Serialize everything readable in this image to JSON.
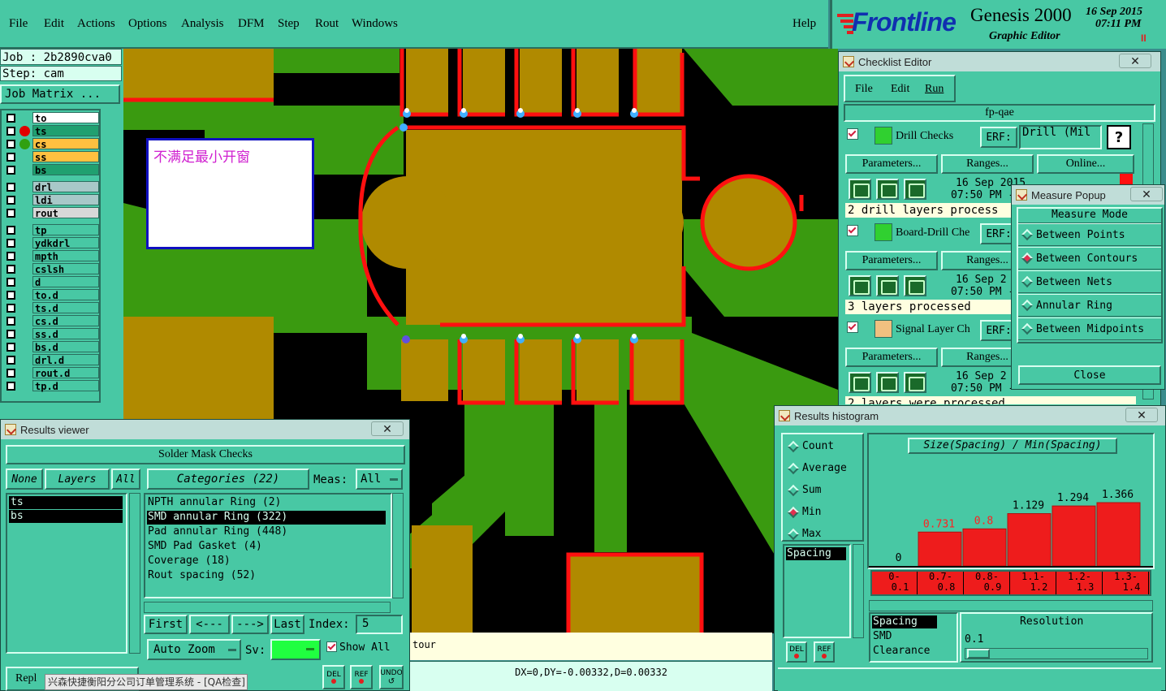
{
  "menubar": {
    "items": [
      "File",
      "Edit",
      "Actions",
      "Options",
      "Analysis",
      "DFM",
      "Step",
      "Rout",
      "Windows"
    ],
    "help": "Help"
  },
  "brand": {
    "logo": "Frontline",
    "product": "Genesis 2000",
    "subtitle": "Graphic Editor",
    "date": "16 Sep 2015",
    "time": "07:11 PM",
    "pause": "II"
  },
  "job": {
    "job_label": "Job : 2b2890cva0",
    "step_label": "Step: cam",
    "matrix_button": "Job Matrix ..."
  },
  "layers": {
    "group1": [
      {
        "name": "to",
        "bg": "#ffffff"
      },
      {
        "name": "ts",
        "bg": "#20a070"
      },
      {
        "name": "cs",
        "bg": "#ffc040"
      },
      {
        "name": "ss",
        "bg": "#ffc040"
      },
      {
        "name": "bs",
        "bg": "#20a070"
      }
    ],
    "group2": [
      {
        "name": "drl",
        "bg": "#a8c8c8"
      },
      {
        "name": "ldi",
        "bg": "#a8c8c8"
      },
      {
        "name": "rout",
        "bg": "#d8d8d8"
      }
    ],
    "group3": [
      {
        "name": "tp"
      },
      {
        "name": "ydkdrl"
      },
      {
        "name": "mpth"
      },
      {
        "name": "cslsh"
      },
      {
        "name": "d"
      },
      {
        "name": "to.d"
      },
      {
        "name": "ts.d"
      },
      {
        "name": "cs.d"
      },
      {
        "name": "ss.d"
      },
      {
        "name": "bs.d"
      },
      {
        "name": "drl.d"
      },
      {
        "name": "rout.d"
      },
      {
        "name": "tp.d"
      }
    ]
  },
  "canvas": {
    "annotation": "不满足最小开窗",
    "status_contour": "tour",
    "coords": "DX=0,DY=-0.00332,D=0.00332"
  },
  "checklist": {
    "title": "Checklist Editor",
    "close": "✕",
    "menu": [
      "File",
      "Edit",
      "Run"
    ],
    "name": "fp-qae",
    "erf_label": "ERF:",
    "help_btn": "?",
    "parameters": "Parameters...",
    "ranges": "Ranges...",
    "online": "Online...",
    "checks": [
      {
        "name": "Drill Checks",
        "erf": "Drill (Mil",
        "date": "16 Sep 2015",
        "time": "07:50 PM -",
        "status": "2 drill layers process"
      },
      {
        "name": "Board-Drill Che",
        "date": "16 Sep 2",
        "time": "07:50 PM -",
        "status": "3 layers processed"
      },
      {
        "name": "Signal Layer Ch",
        "date": "16 Sep 2",
        "time": "07:50 PM -",
        "status": "2 layers were processed"
      }
    ]
  },
  "measure": {
    "title": "Measure Popup",
    "close": "✕",
    "mode_header": "Measure Mode",
    "modes": [
      "Between Points",
      "Between Contours",
      "Between Nets",
      "Annular Ring",
      "Between Midpoints"
    ],
    "selected": "Between Contours",
    "close_btn": "Close"
  },
  "results": {
    "title": "Results viewer",
    "close": "✕",
    "header": "Solder Mask Checks",
    "none_btn": "None",
    "layers_btn": "Layers",
    "all_btn": "All",
    "categories_btn": "Categories (22)",
    "meas_label": "Meas:",
    "meas_value": "All",
    "layer_list": [
      "ts",
      "bs"
    ],
    "categories": [
      "NPTH annular Ring (2)",
      "SMD annular Ring (322)",
      "Pad annular Ring (448)",
      "SMD Pad Gasket (4)",
      "Coverage (18)",
      "Rout spacing (52)"
    ],
    "selected_category": "SMD annular Ring (322)",
    "first": "First",
    "prev": "<---",
    "next": "--->",
    "last": "Last",
    "index_label": "Index:",
    "index_value": "5",
    "autozoom": "Auto Zoom",
    "sv_label": "Sv:",
    "show_all": "Show All",
    "repl": "Repl",
    "del": "DEL",
    "ref": "REF",
    "undo": "UNDO"
  },
  "histogram": {
    "title": "Results histogram",
    "close": "✕",
    "stats": [
      "Count",
      "Average",
      "Sum",
      "Min",
      "Max"
    ],
    "selected_stat": "Min",
    "list": [
      "Spacing"
    ],
    "axis_title": "Size(Spacing) / Min(Spacing)",
    "del": "DEL",
    "ref": "REF",
    "type_list": [
      "Spacing",
      "SMD",
      "Clearance"
    ],
    "resolution_label": "Resolution",
    "resolution_value": "0.1"
  },
  "chart_data": {
    "type": "bar",
    "title": "Size(Spacing) / Min(Spacing)",
    "categories": [
      "0-0.1",
      "0.7-0.8",
      "0.8-0.9",
      "1.1-1.2",
      "1.2-1.3",
      "1.3-1.4"
    ],
    "values": [
      0,
      0.731,
      0.8,
      1.129,
      1.294,
      1.366
    ],
    "value_labels": [
      "0",
      "0.731",
      "0.8",
      "1.129",
      "1.294",
      "1.366"
    ],
    "label_colors": [
      "#000000",
      "#ff2020",
      "#ff2020",
      "#000000",
      "#000000",
      "#000000"
    ],
    "bar_color": "#ee1c1c",
    "ylim": [
      0,
      1.366
    ],
    "grid": false
  },
  "taskbar": {
    "text": "兴森快捷衡阳分公司订单管理系统 - [QA检查]"
  }
}
